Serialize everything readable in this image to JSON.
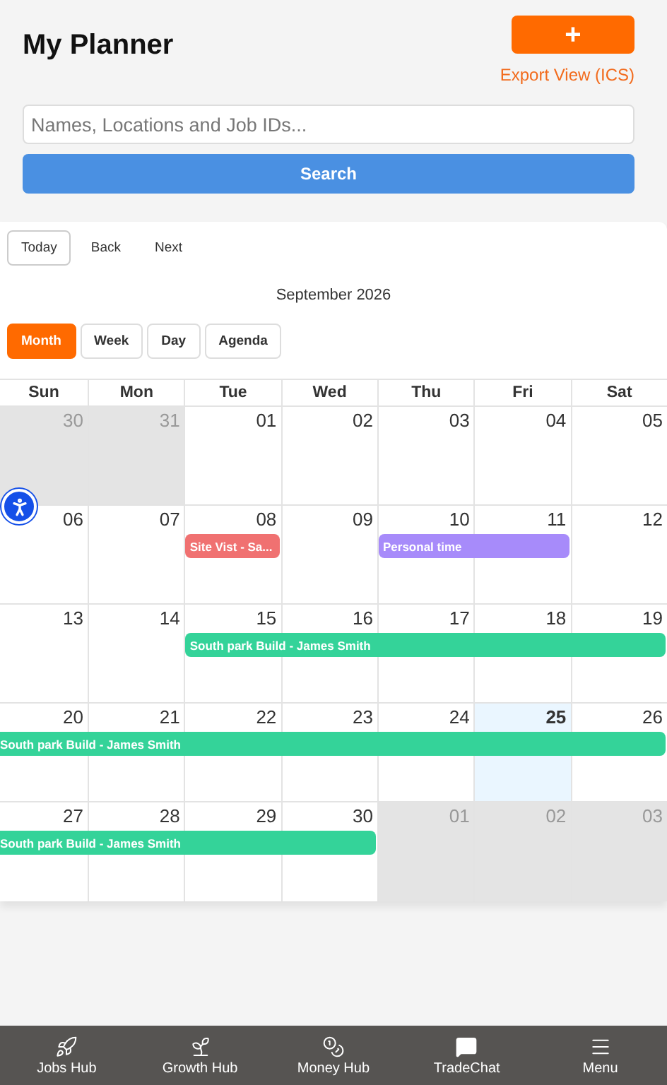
{
  "header": {
    "title": "My Planner",
    "add_button": {
      "label": "+"
    },
    "export_link": "Export View (ICS)"
  },
  "search": {
    "placeholder": "Names, Locations and Job IDs...",
    "button": "Search"
  },
  "calendar": {
    "nav_buttons": [
      {
        "label": "Today",
        "outlined": true
      },
      {
        "label": "Back",
        "outlined": false
      },
      {
        "label": "Next",
        "outlined": false
      }
    ],
    "month_label": "September 2026",
    "views": [
      {
        "label": "Month",
        "selected": true
      },
      {
        "label": "Week",
        "selected": false
      },
      {
        "label": "Day",
        "selected": false
      },
      {
        "label": "Agenda",
        "selected": false
      }
    ],
    "weekdays": [
      "Sun",
      "Mon",
      "Tue",
      "Wed",
      "Thu",
      "Fri",
      "Sat"
    ],
    "weeks": [
      {
        "days": [
          {
            "date": "30",
            "outside": true,
            "today": false
          },
          {
            "date": "31",
            "outside": true,
            "today": false
          },
          {
            "date": "01",
            "outside": false,
            "today": false
          },
          {
            "date": "02",
            "outside": false,
            "today": false
          },
          {
            "date": "03",
            "outside": false,
            "today": false
          },
          {
            "date": "04",
            "outside": false,
            "today": false
          },
          {
            "date": "05",
            "outside": false,
            "today": false
          }
        ]
      },
      {
        "days": [
          {
            "date": "06",
            "outside": false,
            "today": false
          },
          {
            "date": "07",
            "outside": false,
            "today": false
          },
          {
            "date": "08",
            "outside": false,
            "today": false
          },
          {
            "date": "09",
            "outside": false,
            "today": false
          },
          {
            "date": "10",
            "outside": false,
            "today": false
          },
          {
            "date": "11",
            "outside": false,
            "today": false
          },
          {
            "date": "12",
            "outside": false,
            "today": false
          }
        ],
        "events": [
          {
            "title": "Site Vist - Sa...",
            "color": "#f07171",
            "on": [
              false,
              false,
              true,
              false,
              false,
              false,
              false
            ],
            "continued": false
          },
          {
            "title": "Personal time",
            "color": "#a78bfa",
            "on": [
              false,
              false,
              false,
              false,
              true,
              true,
              false
            ],
            "continued": false
          }
        ]
      },
      {
        "days": [
          {
            "date": "13",
            "outside": false,
            "today": false
          },
          {
            "date": "14",
            "outside": false,
            "today": false
          },
          {
            "date": "15",
            "outside": false,
            "today": false
          },
          {
            "date": "16",
            "outside": false,
            "today": false
          },
          {
            "date": "17",
            "outside": false,
            "today": false
          },
          {
            "date": "18",
            "outside": false,
            "today": false
          },
          {
            "date": "19",
            "outside": false,
            "today": false
          }
        ],
        "events": [
          {
            "title": "South park Build - James Smith",
            "color": "#34d399",
            "on": [
              false,
              false,
              true,
              true,
              true,
              true,
              true
            ],
            "continued": false
          }
        ]
      },
      {
        "days": [
          {
            "date": "20",
            "outside": false,
            "today": false
          },
          {
            "date": "21",
            "outside": false,
            "today": false
          },
          {
            "date": "22",
            "outside": false,
            "today": false
          },
          {
            "date": "23",
            "outside": false,
            "today": false
          },
          {
            "date": "24",
            "outside": false,
            "today": false
          },
          {
            "date": "25",
            "outside": false,
            "today": true
          },
          {
            "date": "26",
            "outside": false,
            "today": false
          }
        ],
        "events": [
          {
            "title": "South park Build - James Smith",
            "color": "#34d399",
            "on": [
              true,
              true,
              true,
              true,
              true,
              true,
              true
            ],
            "continued": true
          }
        ]
      },
      {
        "days": [
          {
            "date": "27",
            "outside": false,
            "today": false
          },
          {
            "date": "28",
            "outside": false,
            "today": false
          },
          {
            "date": "29",
            "outside": false,
            "today": false
          },
          {
            "date": "30",
            "outside": false,
            "today": false
          },
          {
            "date": "01",
            "outside": true,
            "today": false
          },
          {
            "date": "02",
            "outside": true,
            "today": false
          },
          {
            "date": "03",
            "outside": true,
            "today": false
          }
        ],
        "events": [
          {
            "title": "South park Build - James Smith",
            "color": "#34d399",
            "on": [
              true,
              true,
              true,
              true,
              false,
              false,
              false
            ],
            "continued": true
          }
        ]
      }
    ]
  },
  "bottom_nav": [
    {
      "label": "Jobs Hub"
    },
    {
      "label": "Growth Hub"
    },
    {
      "label": "Money Hub"
    },
    {
      "label": "TradeChat"
    },
    {
      "label": "Menu"
    }
  ]
}
